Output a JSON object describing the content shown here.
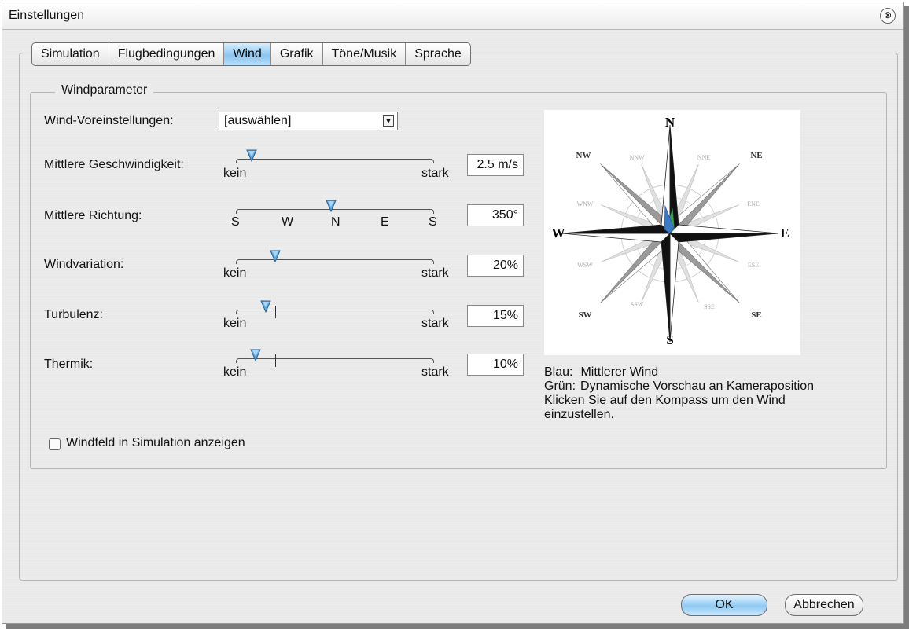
{
  "window": {
    "title": "Einstellungen",
    "close_symbol": "⊗"
  },
  "tabs": [
    {
      "label": "Simulation",
      "active": false
    },
    {
      "label": "Flugbedingungen",
      "active": false
    },
    {
      "label": "Wind",
      "active": true
    },
    {
      "label": "Grafik",
      "active": false
    },
    {
      "label": "Töne/Musik",
      "active": false
    },
    {
      "label": "Sprache",
      "active": false
    }
  ],
  "group": {
    "title": "Windparameter"
  },
  "presets": {
    "label": "Wind-Voreinstellungen:",
    "value": "[auswählen]"
  },
  "params": {
    "speed": {
      "label": "Mittlere Geschwindigkeit:",
      "min_label": "kein",
      "max_label": "stark",
      "value": "2.5 m/s",
      "fraction": 0.08
    },
    "direction": {
      "label": "Mittlere Richtung:",
      "ticks": [
        "S",
        "W",
        "N",
        "E",
        "S"
      ],
      "value": "350°",
      "fraction": 0.48
    },
    "variation": {
      "label": "Windvariation:",
      "min_label": "kein",
      "max_label": "stark",
      "value": "20%",
      "fraction": 0.2
    },
    "turbulence": {
      "label": "Turbulenz:",
      "min_label": "kein",
      "max_label": "stark",
      "value": "15%",
      "fraction": 0.15,
      "marker_fraction": 0.2
    },
    "thermal": {
      "label": "Thermik:",
      "min_label": "kein",
      "max_label": "stark",
      "value": "10%",
      "fraction": 0.1,
      "marker_fraction": 0.2
    }
  },
  "compass": {
    "cardinals": {
      "n": "N",
      "e": "E",
      "s": "S",
      "w": "W"
    },
    "intercardinals": {
      "nw": "NW",
      "ne": "NE",
      "sw": "SW",
      "se": "SE"
    },
    "minor": {
      "nnw": "NNW",
      "nne": "NNE",
      "ene": "ENE",
      "ese": "ESE",
      "sse": "SSE",
      "ssw": "SSW",
      "wsw": "WSW",
      "wnw": "WNW"
    },
    "blue_color": "#3a78c8",
    "green_color": "#3aa05a"
  },
  "legend": {
    "blue_key": "Blau:",
    "blue_text": "Mittlerer Wind",
    "green_key": "Grün:",
    "green_text": "Dynamische Vorschau an Kameraposition",
    "hint_line1": "Klicken Sie auf den Kompass um den Wind",
    "hint_line2": "einzustellen."
  },
  "show_windfield": {
    "label": "Windfeld in Simulation anzeigen",
    "checked": false
  },
  "buttons": {
    "ok": "OK",
    "cancel": "Abbrechen"
  }
}
